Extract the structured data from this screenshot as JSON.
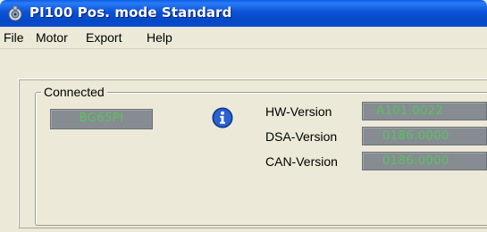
{
  "window": {
    "title": "PI100 Pos. mode Standard",
    "icon": "motor-app-icon"
  },
  "menu": {
    "items": [
      "File",
      "Motor",
      "Export",
      "Help"
    ]
  },
  "connection": {
    "caption": "Connected",
    "device_display": "BG65PI",
    "info_icon": "info-icon"
  },
  "versions": [
    {
      "label": "HW-Version",
      "value": "A101.0022"
    },
    {
      "label": "DSA-Version",
      "value": "0186.0000"
    },
    {
      "label": "CAN-Version",
      "value": "0186.0000"
    }
  ],
  "colors": {
    "titlebar": "#0a52d6",
    "lcd_background": "#878c93",
    "lcd_text": "#55c45a",
    "window_background": "#ece9d8"
  }
}
